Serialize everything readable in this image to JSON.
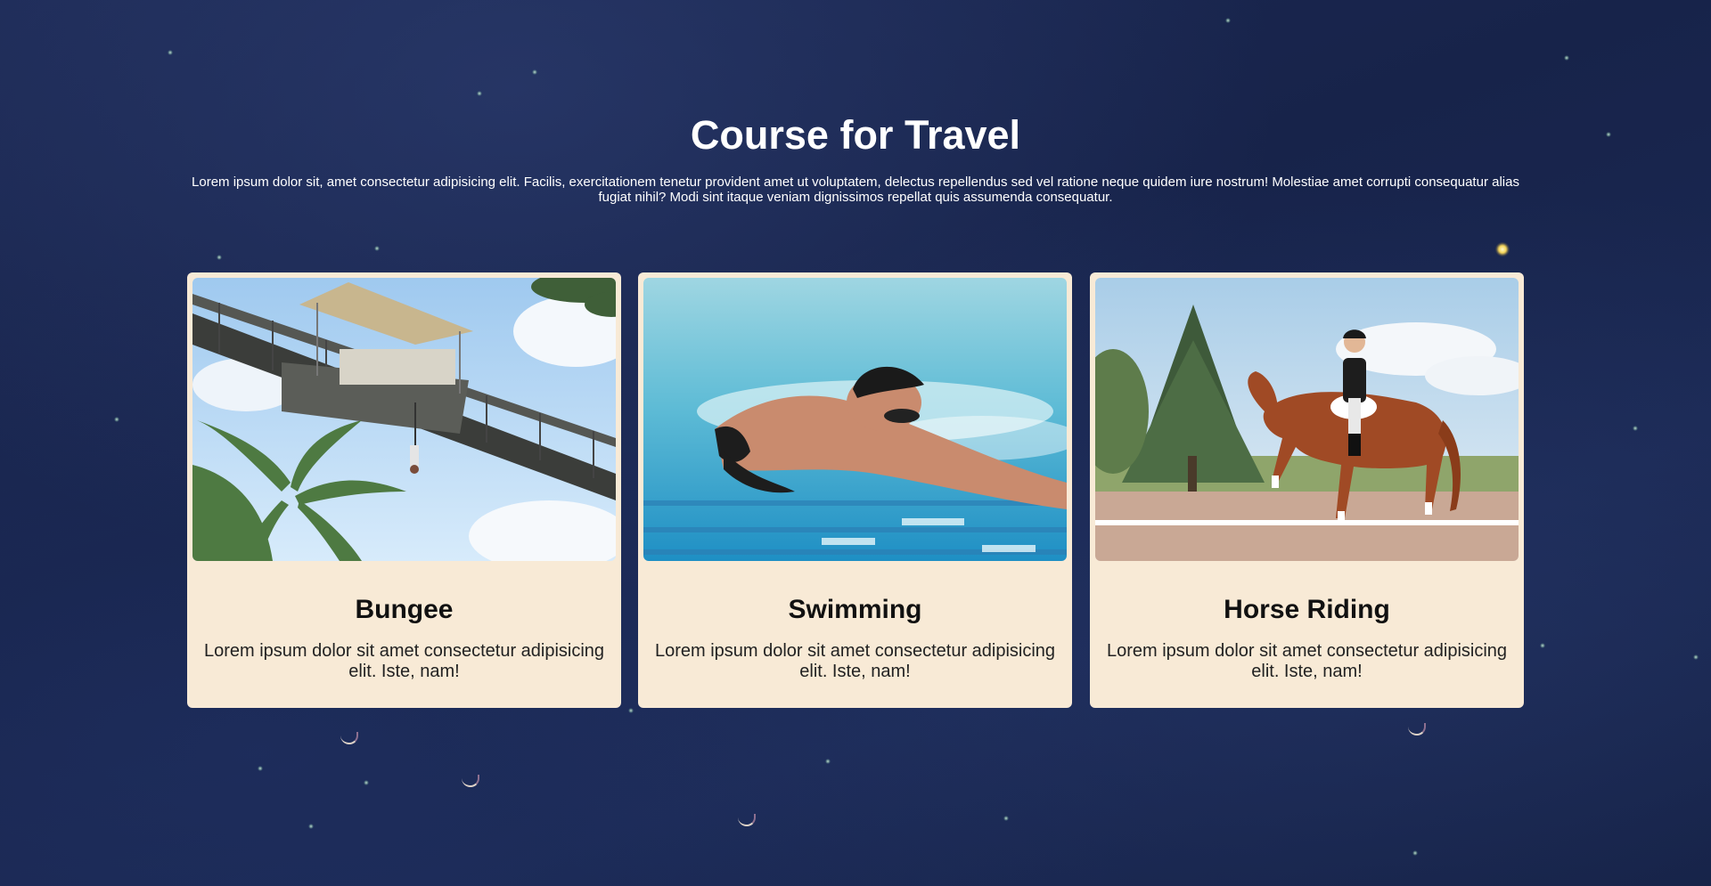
{
  "section": {
    "title": "Course for Travel",
    "description": "Lorem ipsum dolor sit, amet consectetur adipisicing elit. Facilis, exercitationem tenetur provident amet ut voluptatem, delectus repellendus sed vel ratione neque quidem iure nostrum! Molestiae amet corrupti consequatur alias fugiat nihil? Modi sint itaque veniam dignissimos repellat quis assumenda consequatur."
  },
  "courses": [
    {
      "title": "Bungee",
      "text": "Lorem ipsum dolor sit amet consectetur adipisicing elit. Iste, nam!",
      "image": "bungee-bridge-photo"
    },
    {
      "title": "Swimming",
      "text": "Lorem ipsum dolor sit amet consectetur adipisicing elit. Iste, nam!",
      "image": "swimmer-underwater-photo"
    },
    {
      "title": "Horse Riding",
      "text": "Lorem ipsum dolor sit amet consectetur adipisicing elit. Iste, nam!",
      "image": "dressage-horse-rider-photo"
    }
  ],
  "colors": {
    "background": "#1b2850",
    "card": "#f8ead6",
    "title": "#ffffff",
    "card_title": "#111111"
  }
}
